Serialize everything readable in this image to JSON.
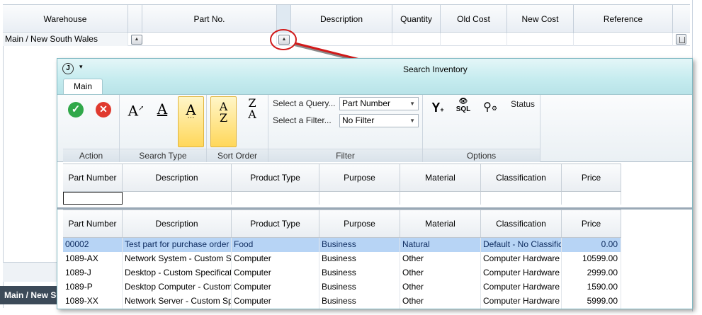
{
  "main_grid": {
    "columns": [
      "Warehouse",
      "Part No.",
      "Description",
      "Quantity",
      "Old Cost",
      "New Cost",
      "Reference"
    ],
    "row": {
      "warehouse": "Main / New South Wales"
    },
    "status_text": "Main / New So"
  },
  "search_window": {
    "title": "Search Inventory",
    "app_icon": "J",
    "qat_label": "▾",
    "tab": "Main",
    "groups": {
      "action": "Action",
      "search_type": "Search Type",
      "sort_order": "Sort Order",
      "filter": "Filter",
      "options": "Options"
    },
    "filter": {
      "query_label": "Select a Query...",
      "query_value": "Part Number",
      "filter_label": "Select a Filter...",
      "filter_value": "No Filter"
    },
    "options": {
      "sql_label": "SQL",
      "status_label": "Status"
    },
    "icons": {
      "ok": "checkmark-icon",
      "cancel": "cancel-icon",
      "search_type": [
        "text-grow-icon",
        "text-underline-icon",
        "text-contains-icon"
      ],
      "sort": [
        "sort-az-icon",
        "sort-za-icon"
      ],
      "options": [
        "filter-add-icon",
        "sql-view-icon",
        "search-settings-icon"
      ]
    },
    "columns": [
      "Part Number",
      "Description",
      "Product Type",
      "Purpose",
      "Material",
      "Classification",
      "Price"
    ],
    "rows": [
      [
        "00002",
        "Test part for purchase order gen",
        "Food",
        "Business",
        "Natural",
        "Default - No Classificati",
        "0.00"
      ],
      [
        "1089-AX",
        "Network System - Custom Specif",
        "Computer",
        "Business",
        "Other",
        "Computer Hardware",
        "10599.00"
      ],
      [
        "1089-J",
        "Desktop - Custom Specifications",
        "Computer",
        "Business",
        "Other",
        "Computer Hardware",
        "2999.00"
      ],
      [
        "1089-P",
        "Desktop Computer  - Custom Sp",
        "Computer",
        "Business",
        "Other",
        "Computer Hardware",
        "1590.00"
      ],
      [
        "1089-XX",
        "Network Server - Custom Specif",
        "Computer",
        "Business",
        "Other",
        "Computer Hardware",
        "5999.00"
      ]
    ]
  },
  "colors": {
    "title_bar": "#c6ecef",
    "selected_row": "#b7d4f5",
    "highlight_button": "#ffd75a",
    "arrow": "#d11a1a"
  }
}
